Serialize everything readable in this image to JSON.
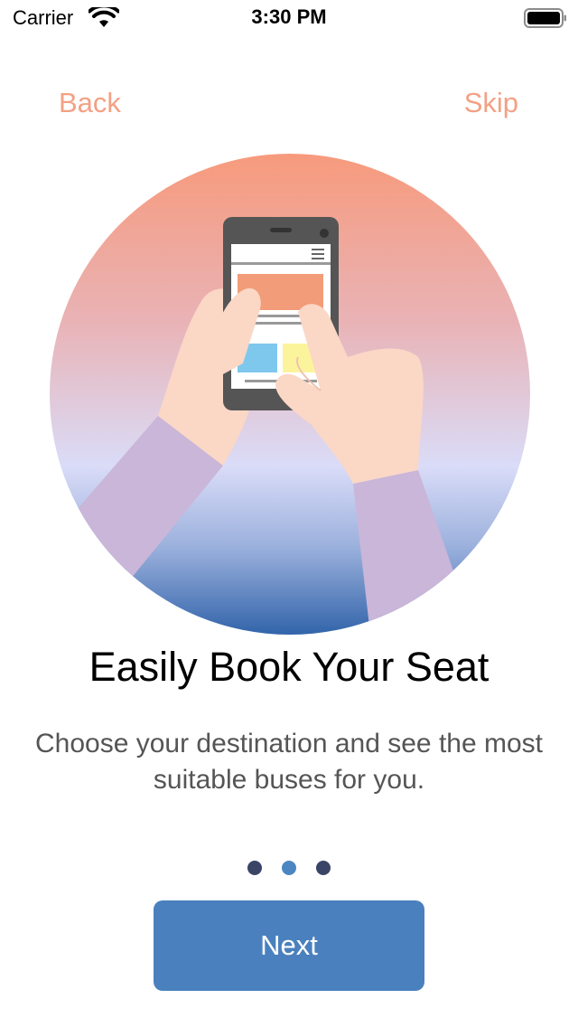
{
  "status_bar": {
    "carrier": "Carrier",
    "time": "3:30 PM",
    "icons": [
      "wifi-icon",
      "battery-icon"
    ]
  },
  "nav": {
    "back_label": "Back",
    "skip_label": "Skip"
  },
  "onboarding": {
    "title": "Easily Book Your Seat",
    "subtitle": "Choose your destination and see the most suitable buses for you.",
    "page_count": 3,
    "current_page": 2,
    "next_label": "Next"
  },
  "colors": {
    "accent": "#f3a185",
    "primary_button": "#4a80bd",
    "dot_inactive": "#3a4466",
    "dot_active": "#4b86c2",
    "illustration_top": "#f79a7c",
    "illustration_mid": "#dadcf8",
    "illustration_bottom": "#3264aa"
  }
}
